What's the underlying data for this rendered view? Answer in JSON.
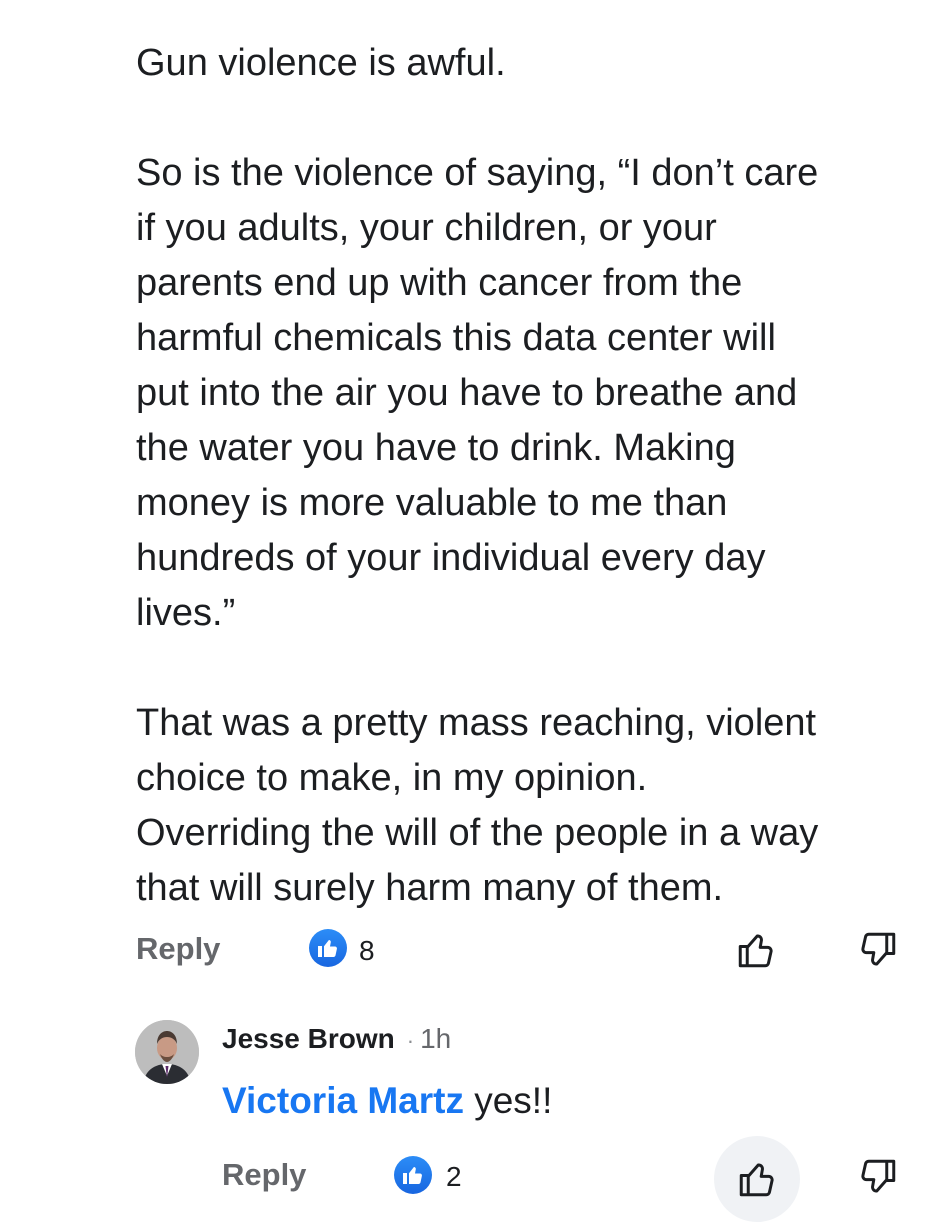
{
  "comment": {
    "paragraphs": [
      [
        "Gun violence is awful."
      ],
      [
        "So is the violence of saying, “I don’t care",
        "if you adults, your children, or your",
        "parents end up with cancer from the",
        "harmful chemicals this data center will",
        "put into the air you have to breathe and",
        "the water you have to drink. Making",
        "money is more valuable to me than",
        "hundreds of your individual every day",
        "lives.”"
      ],
      [
        "That was a pretty mass reaching, violent",
        "choice to make, in my opinion.",
        "Overriding the will of the people in a way",
        "that will surely harm many of them."
      ]
    ],
    "actions": {
      "reply_label": "Reply",
      "like_count": "8",
      "like_icon": "thumbs-up-icon",
      "dislike_icon": "thumbs-down-icon"
    }
  },
  "reply": {
    "author": "Jesse Brown",
    "separator": "·",
    "time": "1h",
    "mention": "Victoria Martz",
    "text": " yes!!",
    "actions": {
      "reply_label": "Reply",
      "like_count": "2"
    }
  },
  "colors": {
    "link_blue": "#1877f2",
    "meta_gray": "#65676b",
    "text": "#1c1e21"
  }
}
